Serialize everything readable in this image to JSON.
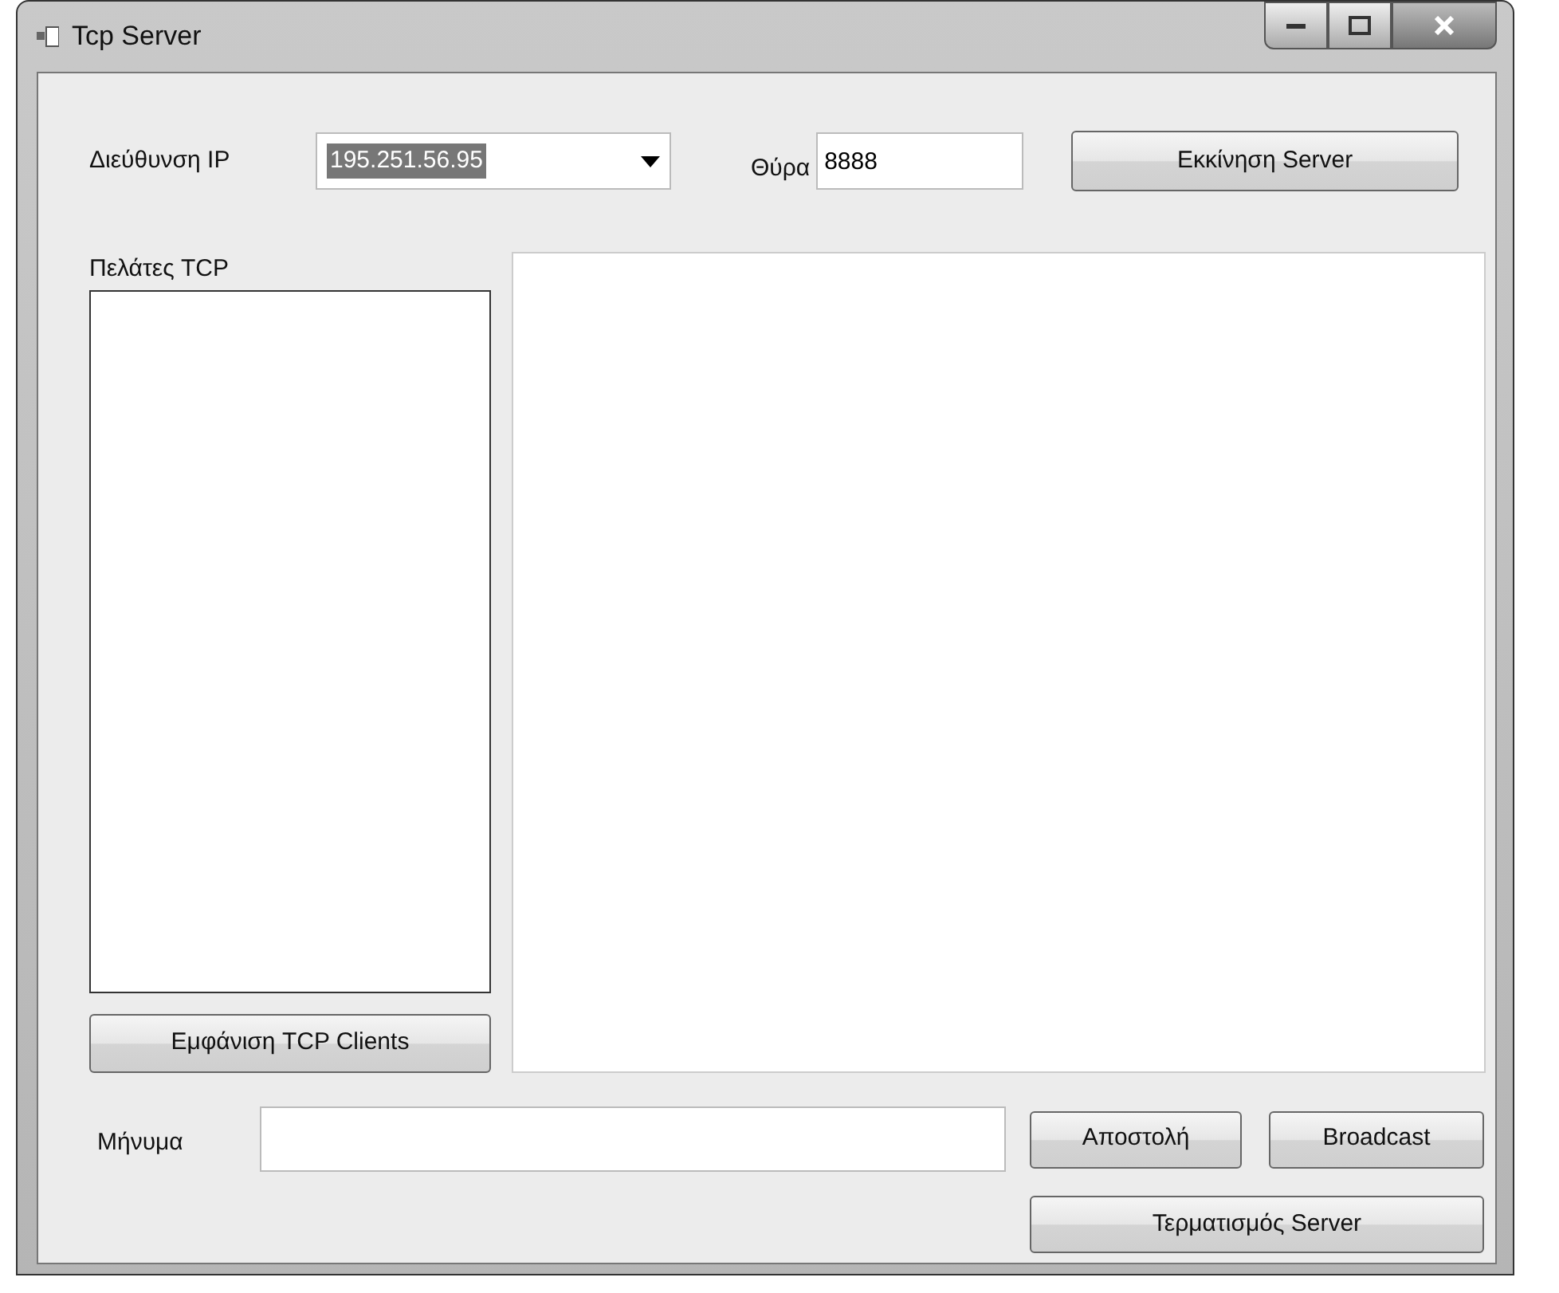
{
  "window": {
    "title": "Tcp Server"
  },
  "ip": {
    "label": "Διεύθυνση IP",
    "value": "195.251.56.95"
  },
  "port": {
    "label": "Θύρα",
    "value": "8888"
  },
  "start_button": "Εκκίνηση Server",
  "clients": {
    "label": "Πελάτες TCP",
    "button": "Εμφάνιση TCP Clients"
  },
  "message": {
    "label": "Μήνυμα"
  },
  "buttons": [
    {
      "label": "Αποστολή"
    },
    {
      "label": "Broadcast"
    }
  ],
  "stop_button": "Τερματισμός Server"
}
